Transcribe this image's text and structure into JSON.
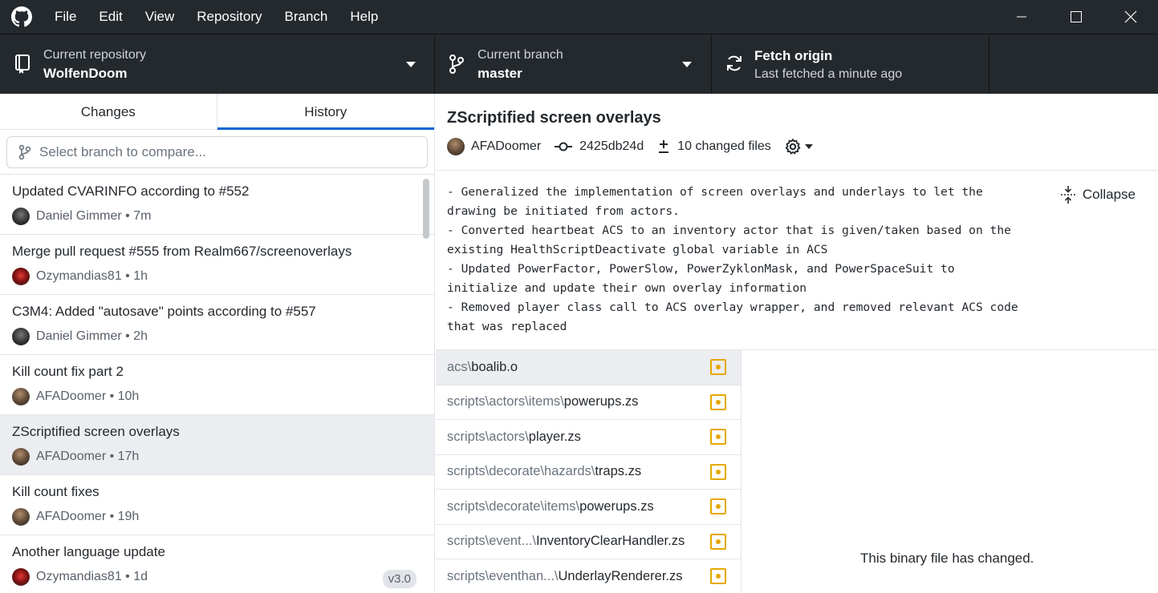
{
  "menu": [
    "File",
    "Edit",
    "View",
    "Repository",
    "Branch",
    "Help"
  ],
  "toolbar": {
    "repo_label": "Current repository",
    "repo_value": "WolfenDoom",
    "branch_label": "Current branch",
    "branch_value": "master",
    "fetch_label": "Fetch origin",
    "fetch_sub": "Last fetched a minute ago"
  },
  "tabs": {
    "changes": "Changes",
    "history": "History"
  },
  "compare": {
    "placeholder": "Select branch to compare..."
  },
  "commits": [
    {
      "title": "Updated CVARINFO according to #552",
      "meta": "Daniel Gimmer • 7m"
    },
    {
      "title": "Merge pull request #555 from Realm667/screenoverlays",
      "meta": "Ozymandias81 • 1h"
    },
    {
      "title": "C3M4: Added \"autosave\" points according to #557",
      "meta": "Daniel Gimmer • 2h"
    },
    {
      "title": "Kill count fix part 2",
      "meta": "AFADoomer • 10h"
    },
    {
      "title": "ZScriptified screen overlays",
      "meta": "AFADoomer • 17h"
    },
    {
      "title": "Kill count fixes",
      "meta": "AFADoomer • 19h"
    },
    {
      "title": "Another language update",
      "meta": "Ozymandias81 • 1d",
      "tag": "v3.0"
    }
  ],
  "detail": {
    "title": "ZScriptified screen overlays",
    "author": "AFADoomer",
    "sha": "2425db24d",
    "changed_files": "10 changed files",
    "description": [
      "- Generalized the implementation of screen overlays and underlays to let the",
      "drawing be initiated from actors.",
      "- Converted heartbeat ACS to an inventory actor that is given/taken based on the",
      "existing HealthScriptDeactivate global variable in ACS",
      "- Updated PowerFactor, PowerSlow, PowerZyklonMask, and PowerSpaceSuit to",
      "initialize and update their own overlay information",
      "- Removed player class call to ACS overlay wrapper, and removed relevant ACS code",
      "that was replaced"
    ],
    "collapse": "Collapse",
    "files": [
      {
        "dir": "acs\\",
        "name": "boalib.o"
      },
      {
        "dir": "scripts\\actors\\items\\",
        "name": "powerups.zs"
      },
      {
        "dir": "scripts\\actors\\",
        "name": "player.zs"
      },
      {
        "dir": "scripts\\decorate\\hazards\\",
        "name": "traps.zs"
      },
      {
        "dir": "scripts\\decorate\\items\\",
        "name": "powerups.zs"
      },
      {
        "dir": "scripts\\event...\\",
        "name": "InventoryClearHandler.zs"
      },
      {
        "dir": "scripts\\eventhan...\\",
        "name": "UnderlayRenderer.zs"
      }
    ],
    "binary_note": "This binary file has changed."
  },
  "colors": {
    "accent": "#0366d6",
    "modified": "#e5a800",
    "dark_bg": "#24292e"
  }
}
